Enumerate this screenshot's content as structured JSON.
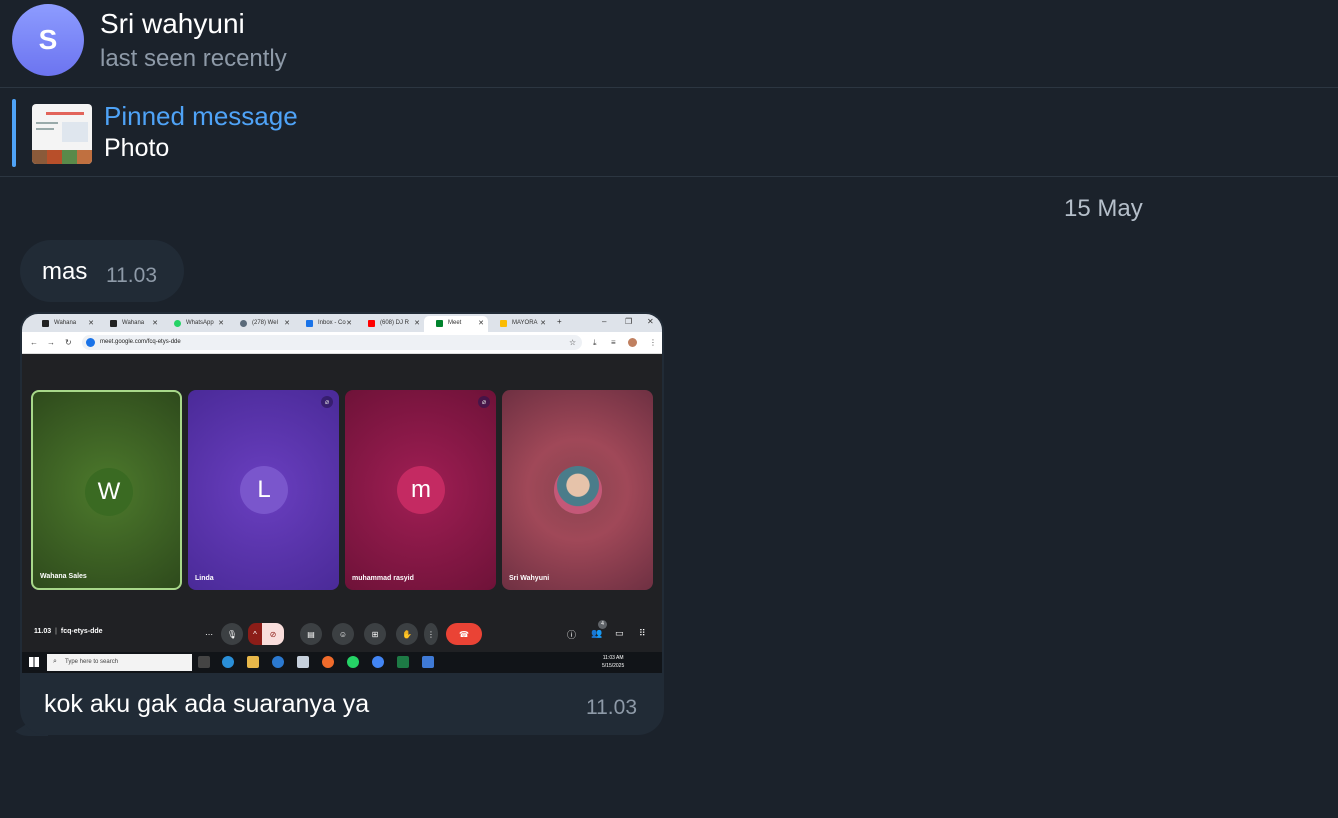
{
  "header": {
    "avatar_letter": "S",
    "name": "Sri wahyuni",
    "status": "last seen recently"
  },
  "pinned": {
    "title": "Pinned message",
    "text": "Photo"
  },
  "date_separator": "15 May",
  "messages": [
    {
      "text": "mas",
      "time": "11.03"
    },
    {
      "caption": "kok aku gak ada suaranya ya",
      "time": "11.03"
    }
  ],
  "screenshot": {
    "tabs": [
      "Wahana",
      "Wahana",
      "WhatsApp",
      "(278) Wel",
      "Inbox - Co",
      "(608) DJ R",
      "Meet",
      "MAYORA"
    ],
    "url": "meet.google.com/fcq-etys-dde",
    "participants": [
      {
        "letter": "W",
        "name": "Wahana Sales"
      },
      {
        "letter": "L",
        "name": "Linda"
      },
      {
        "letter": "m",
        "name": "muhammad rasyid"
      },
      {
        "letter": "",
        "name": "Sri Wahyuni"
      }
    ],
    "meet_time": "11.03",
    "meet_code": "fcq-etys-dde",
    "participant_count": "4",
    "taskbar_search": "Type here to search",
    "clock_time": "11:03 AM",
    "clock_date": "5/15/2025"
  },
  "colors": {
    "background": "#1b222b",
    "bubble": "#212b36",
    "accent": "#4fa3f7",
    "muted": "#8e9aa8"
  }
}
